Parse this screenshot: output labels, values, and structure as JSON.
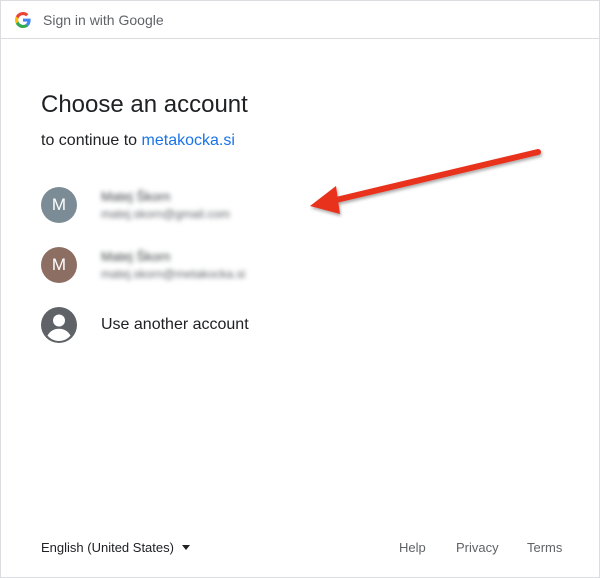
{
  "topbar": {
    "title": "Sign in with Google",
    "logo_icon": "google-g-icon"
  },
  "main": {
    "heading": "Choose an account",
    "subtitle_prefix": "to continue to ",
    "site_link": "metakocka.si"
  },
  "accounts": [
    {
      "initial": "M",
      "avatar_color": "#7b8c96",
      "name": "Matej Škorn",
      "email": "matej.skorn@gmail.com"
    },
    {
      "initial": "M",
      "avatar_color": "#8d6e63",
      "name": "Matej Škorn",
      "email": "matej.skorn@metakocka.si"
    }
  ],
  "another_account": {
    "label": "Use another account",
    "icon": "account-circle-icon"
  },
  "footer": {
    "language": "English (United States)",
    "help": "Help",
    "privacy": "Privacy",
    "terms": "Terms"
  },
  "annotation": {
    "arrow_color": "#e8321f"
  }
}
